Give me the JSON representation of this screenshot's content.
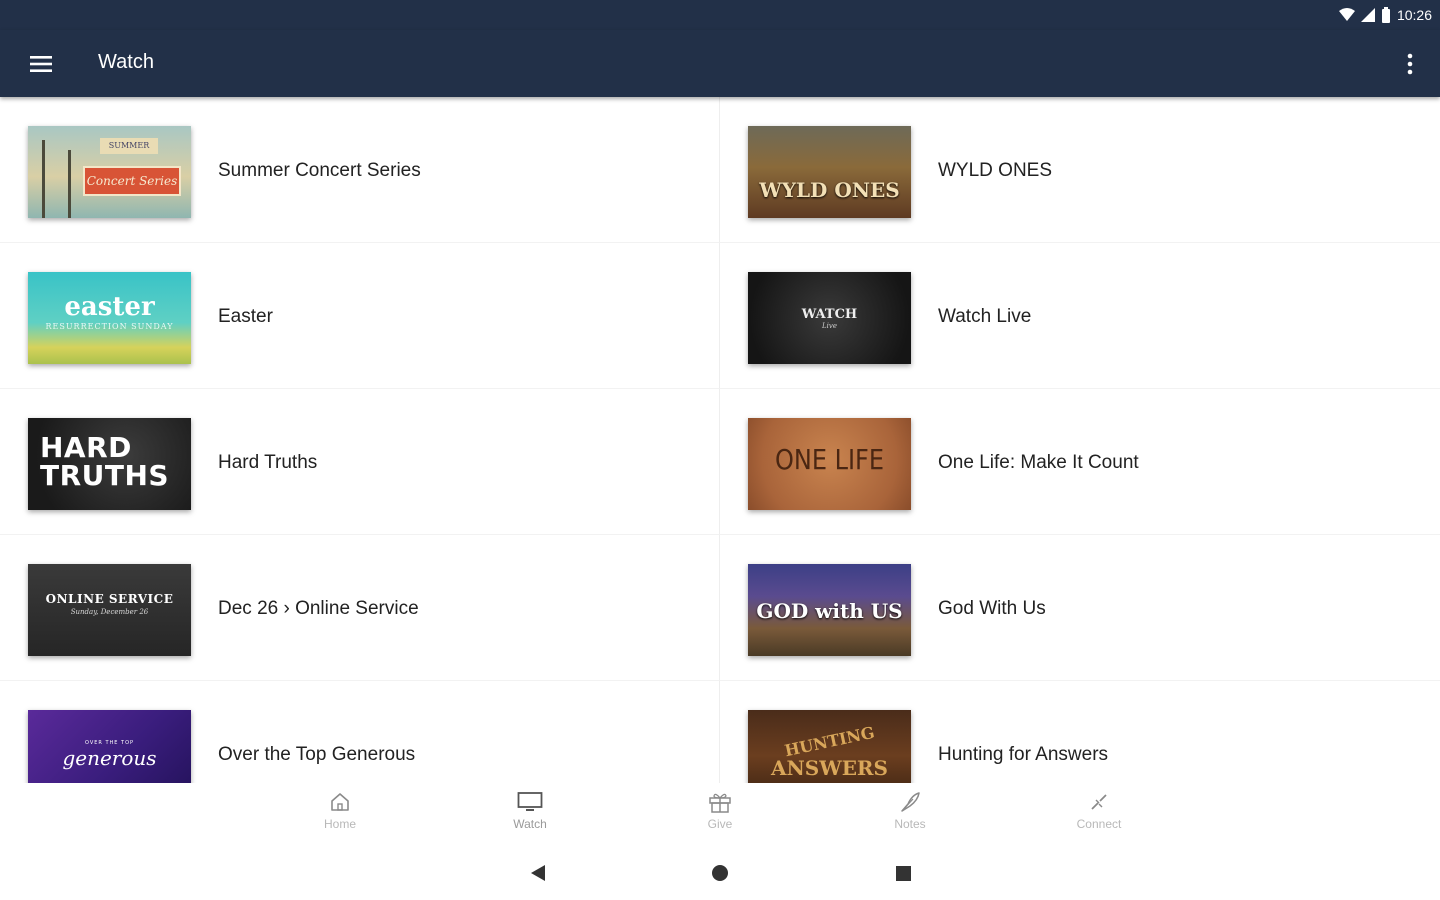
{
  "status_bar": {
    "time": "10:26"
  },
  "app_bar": {
    "title": "Watch"
  },
  "items": [
    {
      "label": "Summer Concert Series",
      "thumb": {
        "top_text": "SUMMER",
        "sign_text": "Concert Series"
      }
    },
    {
      "label": "WYLD ONES",
      "thumb": {
        "text": "WYLD ONES"
      }
    },
    {
      "label": "Easter",
      "thumb": {
        "big": "easter",
        "small": "RESURRECTION SUNDAY"
      }
    },
    {
      "label": "Watch Live",
      "thumb": {
        "text": "WATCH",
        "sub": "Live"
      }
    },
    {
      "label": "Hard Truths",
      "thumb": {
        "line1": "HARD",
        "line2": "TRUTHS"
      }
    },
    {
      "label": "One Life: Make It Count",
      "thumb": {
        "text": "ONE LIFE"
      }
    },
    {
      "label": "Dec 26 › Online Service",
      "thumb": {
        "text": "ONLINE SERVICE",
        "sub": "Sunday, December 26"
      }
    },
    {
      "label": "God With Us",
      "thumb": {
        "text": "GOD with US"
      }
    },
    {
      "label": "Over the Top Generous",
      "thumb": {
        "sub": "OVER THE TOP",
        "text": "generous"
      }
    },
    {
      "label": "Hunting for Answers",
      "thumb": {
        "line1": "HUNTING",
        "line2": "ANSWERS"
      }
    }
  ],
  "bottom_nav": [
    {
      "label": "Home",
      "icon": "home-icon"
    },
    {
      "label": "Watch",
      "icon": "tv-icon"
    },
    {
      "label": "Give",
      "icon": "gift-icon"
    },
    {
      "label": "Notes",
      "icon": "quill-icon"
    },
    {
      "label": "Connect",
      "icon": "connect-icon"
    }
  ],
  "colors": {
    "app_bar": "#223048",
    "nav_label": "#b8b8b8"
  }
}
